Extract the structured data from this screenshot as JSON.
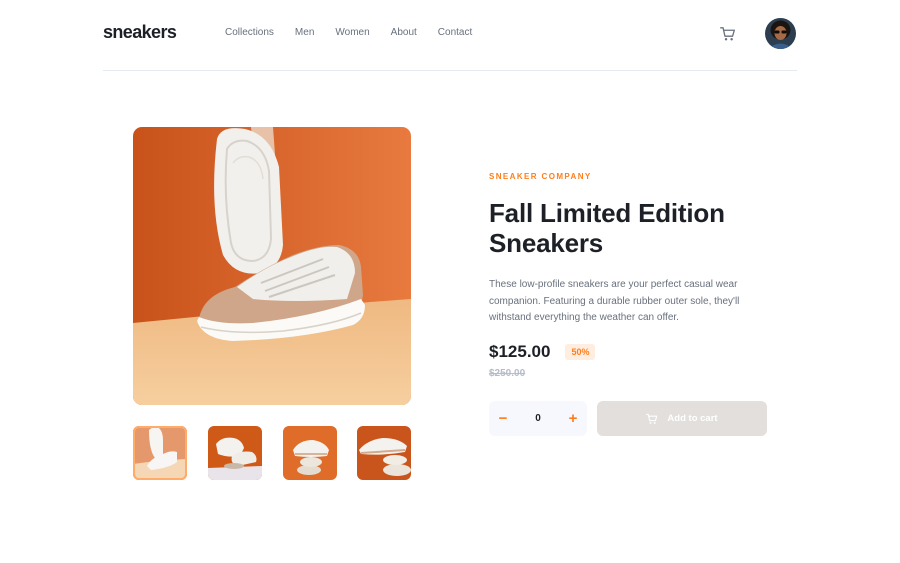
{
  "brand": {
    "logo": "sneakers"
  },
  "nav": [
    "Collections",
    "Men",
    "Women",
    "About",
    "Contact"
  ],
  "header_icons": {
    "cart": "cart-icon",
    "avatar": "user-avatar"
  },
  "product": {
    "company": "SNEAKER COMPANY",
    "title": "Fall Limited Edition Sneakers",
    "description": "These low-profile sneakers are your perfect casual wear companion. Featuring a durable rubber outer sole, they'll withstand everything the weather can offer.",
    "price": "$125.00",
    "discount": "50%",
    "original_price": "$250.00"
  },
  "quantity": {
    "minus": "−",
    "value": "0",
    "plus": "+"
  },
  "cart_button": {
    "label": "Add to cart",
    "icon": "cart-icon"
  },
  "gallery": {
    "selected_index": 0,
    "thumbnail_count": 4
  },
  "colors": {
    "accent": "#ff7e1b",
    "accent_pale": "#ffede0",
    "text_dark": "#1d2026",
    "text_gray": "#69707d",
    "button_disabled": "#e3dfdc"
  }
}
